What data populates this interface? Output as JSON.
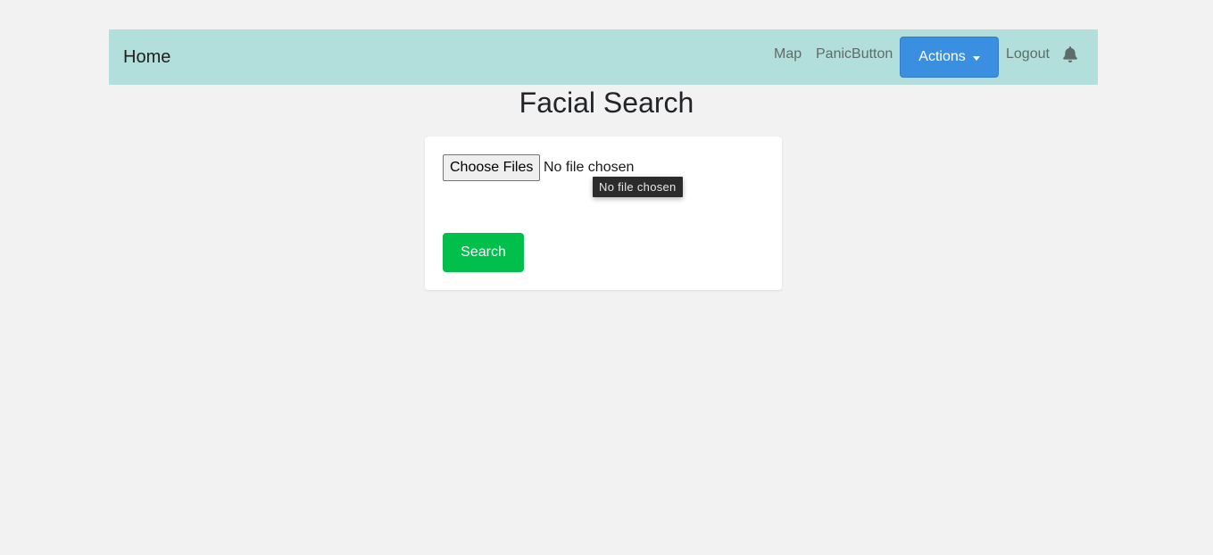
{
  "navbar": {
    "brand": "Home",
    "links": {
      "map": "Map",
      "panic": "PanicButton",
      "logout": "Logout"
    },
    "actions_label": "Actions",
    "bell_icon": "bell-icon",
    "background_color": "#b2dfdb"
  },
  "main": {
    "title": "Facial Search",
    "file_input": {
      "button_label": "Choose Files",
      "status": "No file chosen",
      "tooltip": "No file chosen"
    },
    "search_label": "Search"
  },
  "colors": {
    "actions_button": "#3b8fe0",
    "search_button": "#00c04b",
    "page_background": "#f2f2f2"
  }
}
